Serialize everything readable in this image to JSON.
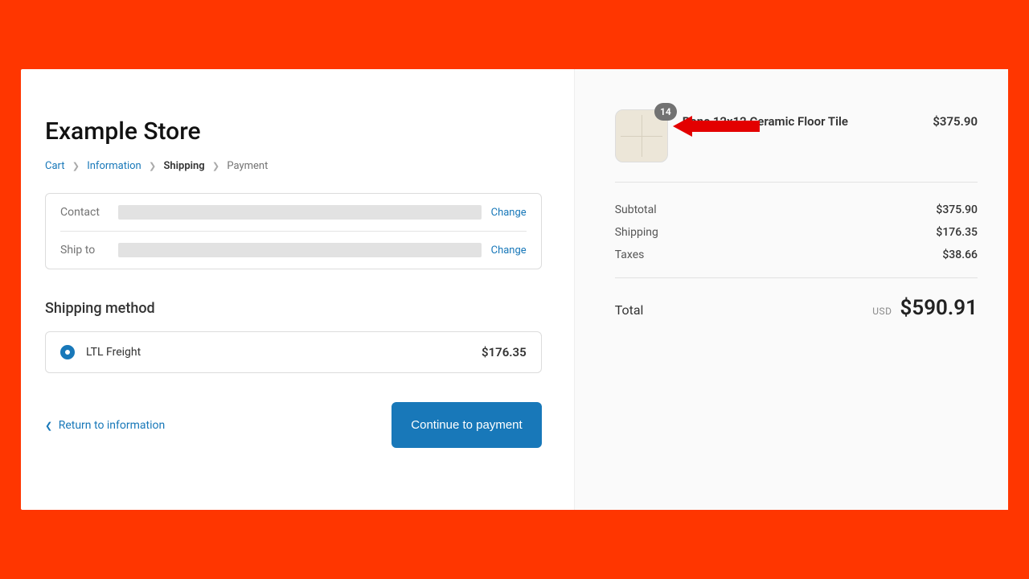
{
  "store": {
    "title": "Example Store"
  },
  "breadcrumb": {
    "cart": "Cart",
    "information": "Information",
    "shipping": "Shipping",
    "payment": "Payment"
  },
  "info": {
    "contact_label": "Contact",
    "shipto_label": "Ship to",
    "change": "Change"
  },
  "shipping_method": {
    "title": "Shipping method",
    "option_name": "LTL Freight",
    "option_price": "$176.35"
  },
  "actions": {
    "return": "Return to information",
    "continue": "Continue to payment"
  },
  "cart": {
    "item_name": "Bone 12x12 Ceramic Floor Tile",
    "item_qty": "14",
    "item_price": "$375.90"
  },
  "summary": {
    "subtotal_label": "Subtotal",
    "subtotal_value": "$375.90",
    "shipping_label": "Shipping",
    "shipping_value": "$176.35",
    "taxes_label": "Taxes",
    "taxes_value": "$38.66",
    "total_label": "Total",
    "currency": "USD",
    "total_value": "$590.91"
  }
}
